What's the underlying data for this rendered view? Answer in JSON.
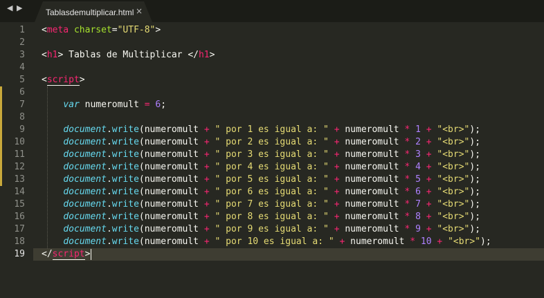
{
  "tab": {
    "title": "Tablasdemultiplicar.html",
    "close": "×"
  },
  "nav": {
    "back": "◀",
    "forward": "▶"
  },
  "gutter": {
    "line_numbers": [
      "1",
      "2",
      "3",
      "4",
      "5",
      "6",
      "7",
      "8",
      "9",
      "10",
      "11",
      "12",
      "13",
      "14",
      "15",
      "16",
      "17",
      "18",
      "19"
    ]
  },
  "code": {
    "l1": [
      [
        "pl",
        "<"
      ],
      [
        "tg",
        "meta"
      ],
      [
        "pl",
        " "
      ],
      [
        "at",
        "charset"
      ],
      [
        "pl",
        "="
      ],
      [
        "st",
        "\"UTF-8\""
      ],
      [
        "pl",
        ">"
      ]
    ],
    "l3": [
      [
        "pl",
        "<"
      ],
      [
        "tg",
        "h1"
      ],
      [
        "pl",
        "> Tablas de Multiplicar </"
      ],
      [
        "tg",
        "h1"
      ],
      [
        "pl",
        ">"
      ]
    ],
    "l5": [
      [
        "pl",
        "<"
      ],
      [
        "tg",
        "script"
      ],
      [
        "pl",
        ">"
      ]
    ],
    "l7": [
      [
        "pl",
        "    "
      ],
      [
        "kw",
        "var"
      ],
      [
        "pl",
        " numeromult "
      ],
      [
        "op",
        "="
      ],
      [
        "pl",
        " "
      ],
      [
        "nm",
        "6"
      ],
      [
        "pl",
        ";"
      ]
    ],
    "rows": [
      {
        "line": 9,
        "n": "1"
      },
      {
        "line": 10,
        "n": "2"
      },
      {
        "line": 11,
        "n": "3"
      },
      {
        "line": 12,
        "n": "4"
      },
      {
        "line": 13,
        "n": "5"
      },
      {
        "line": 14,
        "n": "6"
      },
      {
        "line": 15,
        "n": "7"
      },
      {
        "line": 16,
        "n": "8"
      },
      {
        "line": 17,
        "n": "9"
      },
      {
        "line": 18,
        "n": "10"
      }
    ],
    "doc_word": "document",
    "write_word": "write",
    "row_open": "(numeromult ",
    "plus": "+",
    "str_left": "\" por ",
    "str_right": " es igual a: \"",
    "mult_var": " numeromult ",
    "times": "*",
    "br": "\"<br>\"",
    "row_close": ");",
    "l19": [
      [
        "pl",
        "</"
      ],
      [
        "tg",
        "script"
      ],
      [
        "pl",
        ">"
      ]
    ]
  },
  "colors": {
    "background": "#272822",
    "tag": "#f92672",
    "string": "#e6db74",
    "number": "#ae81ff",
    "support": "#66d9ef"
  }
}
